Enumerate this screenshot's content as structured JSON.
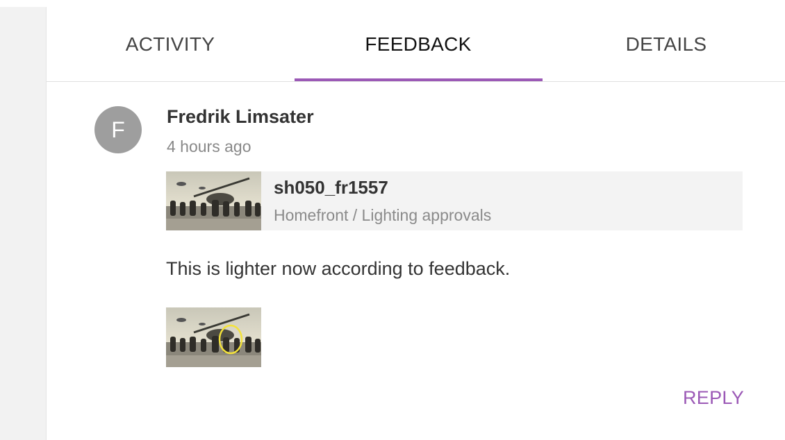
{
  "tabs": [
    {
      "label": "ACTIVITY"
    },
    {
      "label": "FEEDBACK"
    },
    {
      "label": "DETAILS"
    }
  ],
  "active_tab_index": 1,
  "accent_color": "#9b59b6",
  "feedback": {
    "avatar_initial": "F",
    "author": "Fredrik Limsater",
    "time": "4 hours ago",
    "version": {
      "name": "sh050_fr1557",
      "path": "Homefront / Lighting approvals"
    },
    "message": "This is lighter now according to feedback.",
    "reply_label": "REPLY"
  }
}
